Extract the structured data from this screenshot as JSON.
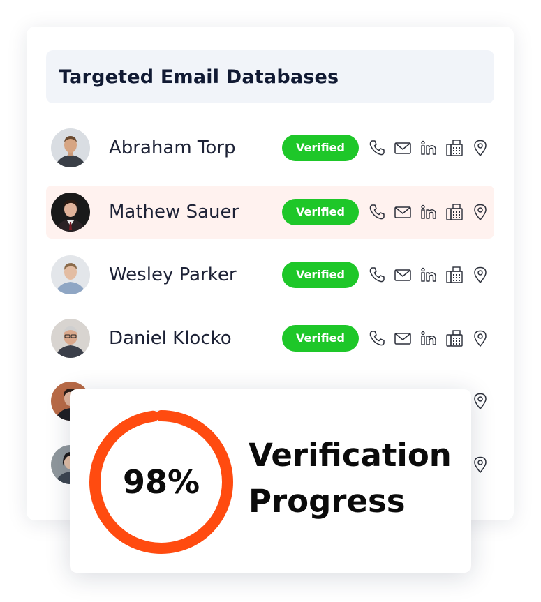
{
  "header": {
    "title": "Targeted Email Databases"
  },
  "status_color": "#1ec729",
  "accent_color": "#ff4b10",
  "contact_icons": [
    "phone-icon",
    "email-icon",
    "linkedin-icon",
    "fax-icon",
    "location-icon"
  ],
  "contacts": [
    {
      "name": "Abraham Torp",
      "status": "Verified",
      "highlighted": false
    },
    {
      "name": "Mathew Sauer",
      "status": "Verified",
      "highlighted": true
    },
    {
      "name": "Wesley Parker",
      "status": "Verified",
      "highlighted": false
    },
    {
      "name": "Daniel Klocko",
      "status": "Verified",
      "highlighted": false
    },
    {
      "name": "",
      "status": "",
      "highlighted": false
    },
    {
      "name": "",
      "status": "",
      "highlighted": false
    }
  ],
  "progress": {
    "percent_label": "98%",
    "value_fraction": 0.98,
    "label_line1": "Verification",
    "label_line2": "Progress"
  }
}
